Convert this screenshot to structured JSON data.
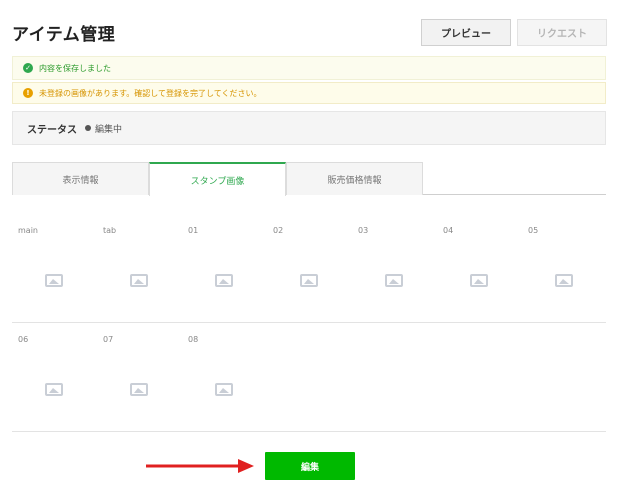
{
  "header": {
    "title": "アイテム管理",
    "preview_label": "プレビュー",
    "request_label": "リクエスト"
  },
  "alerts": {
    "success": {
      "icon": "check-circle-icon",
      "icon_glyph": "✓",
      "text": "内容を保存しました"
    },
    "warning": {
      "icon": "exclamation-circle-icon",
      "icon_glyph": "!",
      "text": "未登録の画像があります。確認して登録を完了してください。"
    }
  },
  "status": {
    "label": "ステータス",
    "value": "編集中"
  },
  "tabs": [
    {
      "label": "表示情報"
    },
    {
      "label": "スタンプ画像"
    },
    {
      "label": "販売価格情報"
    }
  ],
  "active_tab": "スタンプ画像",
  "slots": [
    {
      "label": "main"
    },
    {
      "label": "tab"
    },
    {
      "label": "01"
    },
    {
      "label": "02"
    },
    {
      "label": "03"
    },
    {
      "label": "04"
    },
    {
      "label": "05"
    },
    {
      "label": "06"
    },
    {
      "label": "07"
    },
    {
      "label": "08"
    }
  ],
  "footer": {
    "edit_label": "編集"
  },
  "colors": {
    "accent_green": "#00b900",
    "success_text": "#2a9a2a",
    "warning_text": "#d69400",
    "arrow_red": "#e02020"
  }
}
